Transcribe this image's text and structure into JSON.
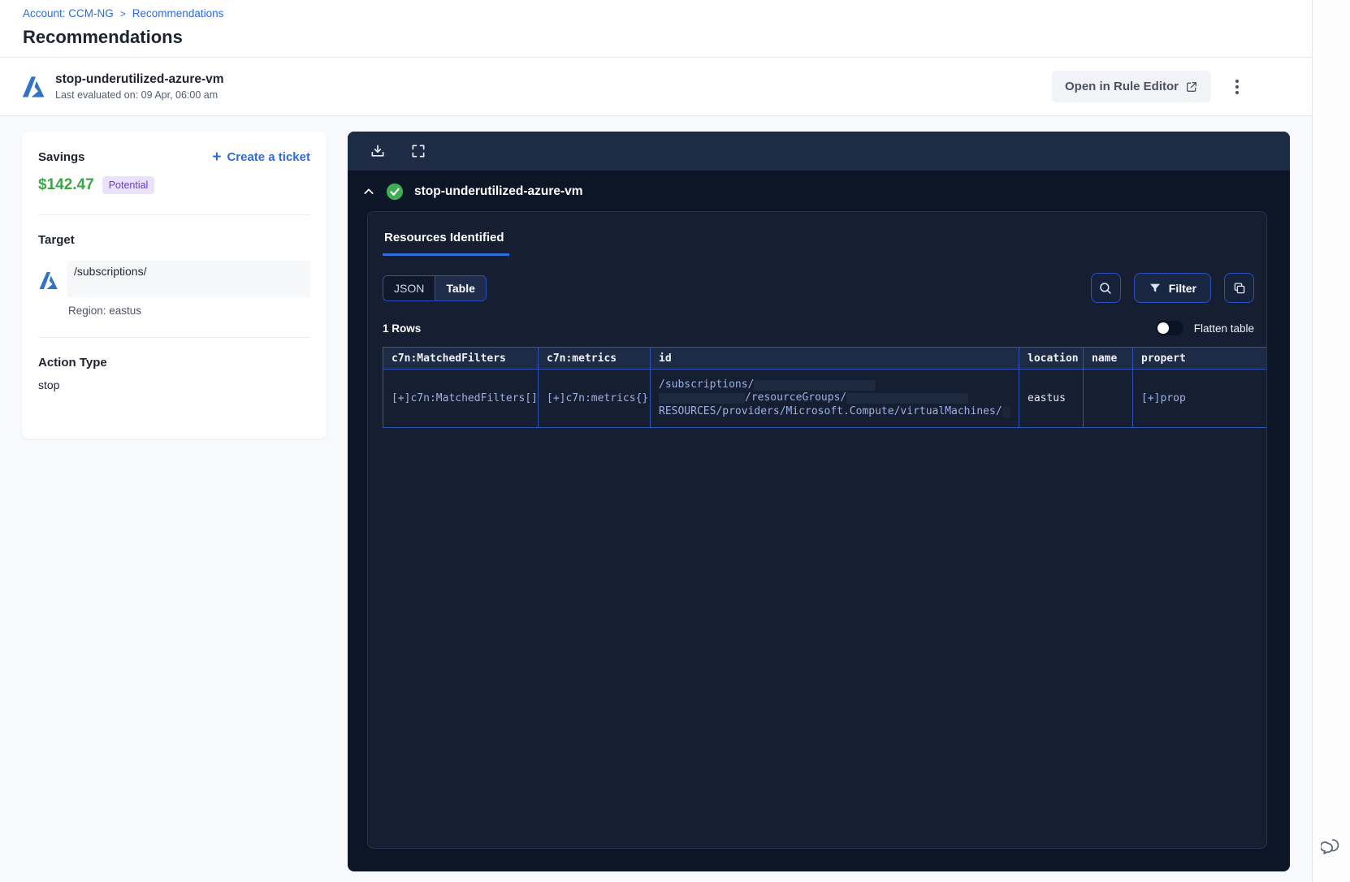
{
  "breadcrumb": {
    "account": "Account: CCM-NG",
    "separator": ">",
    "page": "Recommendations"
  },
  "page_title": "Recommendations",
  "rule_header": {
    "title": "stop-underutilized-azure-vm",
    "last_evaluated": "Last evaluated on: 09 Apr, 06:00 am",
    "open_button_label": "Open in Rule Editor"
  },
  "savings": {
    "label": "Savings",
    "amount": "$142.47",
    "badge": "Potential",
    "plus_icon": "+",
    "create_ticket_label": "Create a ticket"
  },
  "target": {
    "label": "Target",
    "path": "/subscriptions/",
    "region": "Region: eastus"
  },
  "action": {
    "label": "Action Type",
    "value": "stop"
  },
  "panel": {
    "rule_title": "stop-underutilized-azure-vm",
    "tab_label": "Resources Identified",
    "view_json_label": "JSON",
    "view_table_label": "Table",
    "filter_label": "Filter",
    "rows_count": "1 Rows",
    "flatten_label": "Flatten table",
    "table": {
      "columns": [
        "c7n:MatchedFilters",
        "c7n:metrics",
        "id",
        "location",
        "name",
        "propert"
      ],
      "row": {
        "matched_filters": "[+]c7n:MatchedFilters[]",
        "metrics": "[+]c7n:metrics{}",
        "id_line1": "/subscriptions/",
        "id_line2": "/resourceGroups/",
        "id_line3": "RESOURCES/providers/Microsoft.Compute/virtualMachines/",
        "location": "eastus",
        "name": "",
        "properties": "[+]prop"
      }
    }
  },
  "icons": {
    "azure_logo": "azure-triangle-logo",
    "external_link": "box-with-arrow",
    "kebab": "three-vertical-dots",
    "download": "arrow-into-tray",
    "fullscreen": "corner-brackets",
    "collapse": "chevron-up",
    "status": "green-check-circle",
    "search": "magnifier",
    "filter": "funnel",
    "copy": "overlapping-squares",
    "chat": "speech-bubbles"
  },
  "colors": {
    "accent_blue": "#2c6be4",
    "savings_green": "#3fa44a",
    "badge_purple_text": "#6d3bdb",
    "badge_purple_bg": "#eae1fb",
    "panel_bg": "#0c1627",
    "panel_toolbar_bg": "#1e2b45",
    "inner_card_bg": "#151f31",
    "table_border_blue": "#3056b4",
    "cell_text_periwinkle": "#9db1e3",
    "check_green": "#3fae53"
  }
}
